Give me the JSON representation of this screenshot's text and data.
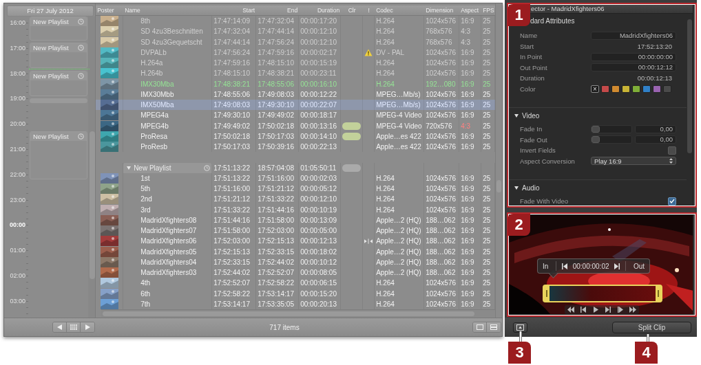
{
  "calendar": {
    "date": "Fri 27 July 2012",
    "hours": [
      {
        "label": "16:00",
        "emphasized": false
      },
      {
        "label": "17:00",
        "emphasized": false
      },
      {
        "label": "18:00",
        "emphasized": false
      },
      {
        "label": "19:00",
        "emphasized": false
      },
      {
        "label": "20:00",
        "emphasized": false
      },
      {
        "label": "21:00",
        "emphasized": false
      },
      {
        "label": "22:00",
        "emphasized": false
      },
      {
        "label": "23:00",
        "emphasized": false
      },
      {
        "label": "00:00",
        "emphasized": true
      },
      {
        "label": "01:00",
        "emphasized": false
      },
      {
        "label": "02:00",
        "emphasized": false
      },
      {
        "label": "03:00",
        "emphasized": false
      }
    ],
    "blocks": [
      {
        "kind": "playlist",
        "title": "New Playlist"
      },
      {
        "kind": "playlist",
        "title": "New Playlist"
      },
      {
        "kind": "playlist",
        "title": "New Playlist"
      },
      {
        "kind": "bar"
      },
      {
        "kind": "playlist",
        "title": "New Playlist"
      }
    ]
  },
  "table": {
    "columns": [
      "Poster",
      "Name",
      "Start",
      "End",
      "Duration",
      "Clr",
      "!",
      "Codec",
      "Dimension",
      "Aspect",
      "FPS"
    ],
    "rows": [
      {
        "kind": "clip",
        "name": "8th",
        "start": "17:47:14:09",
        "end": "17:47:32:04",
        "duration": "00:00:17:20",
        "codec": "H.264",
        "dimension": "1024x576",
        "aspect": "16:9",
        "fps": "25",
        "offline": true,
        "playing": false,
        "selected": false,
        "warning": false,
        "split": false,
        "aspect_warning": false
      },
      {
        "kind": "clip",
        "name": "SD 4zu3Beschnitten",
        "start": "17:47:32:04",
        "end": "17:47:44:14",
        "duration": "00:00:12:10",
        "codec": "H.264",
        "dimension": "768x576",
        "aspect": "4:3",
        "fps": "25",
        "offline": true,
        "playing": false,
        "selected": false,
        "warning": false,
        "split": false,
        "aspect_warning": false
      },
      {
        "kind": "clip",
        "name": "SD 4zu3Gequetscht",
        "start": "17:47:44:14",
        "end": "17:47:56:24",
        "duration": "00:00:12:10",
        "codec": "H.264",
        "dimension": "768x576",
        "aspect": "4:3",
        "fps": "25",
        "offline": true,
        "playing": false,
        "selected": false,
        "warning": false,
        "split": false,
        "aspect_warning": false
      },
      {
        "kind": "clip",
        "name": "DVPALb",
        "start": "17:47:56:24",
        "end": "17:47:59:16",
        "duration": "00:00:02:17",
        "codec": "DV - PAL",
        "dimension": "1024x576",
        "aspect": "16:9",
        "fps": "25",
        "offline": true,
        "playing": false,
        "selected": false,
        "warning": true,
        "split": false,
        "aspect_warning": false
      },
      {
        "kind": "clip",
        "name": "H.264a",
        "start": "17:47:59:16",
        "end": "17:48:15:10",
        "duration": "00:00:15:19",
        "codec": "H.264",
        "dimension": "1024x576",
        "aspect": "16:9",
        "fps": "25",
        "offline": true,
        "playing": false,
        "selected": false,
        "warning": false,
        "split": false,
        "aspect_warning": false
      },
      {
        "kind": "clip",
        "name": "H.264b",
        "start": "17:48:15:10",
        "end": "17:48:38:21",
        "duration": "00:00:23:11",
        "codec": "H.264",
        "dimension": "1024x576",
        "aspect": "16:9",
        "fps": "25",
        "offline": true,
        "playing": false,
        "selected": false,
        "warning": false,
        "split": false,
        "aspect_warning": false
      },
      {
        "kind": "clip",
        "name": "IMX30Mba",
        "start": "17:48:38:21",
        "end": "17:48:55:06",
        "duration": "00:00:16:10",
        "codec": "H.264",
        "dimension": "192…080",
        "aspect": "16:9",
        "fps": "25",
        "offline": false,
        "playing": true,
        "selected": false,
        "warning": false,
        "split": false,
        "aspect_warning": false
      },
      {
        "kind": "clip",
        "name": "IMX30Mbb",
        "start": "17:48:55:06",
        "end": "17:49:08:03",
        "duration": "00:00:12:22",
        "codec": "MPEG…Mb/s)",
        "dimension": "1024x576",
        "aspect": "16:9",
        "fps": "25",
        "offline": false,
        "playing": false,
        "selected": false,
        "warning": false,
        "split": false,
        "aspect_warning": false
      },
      {
        "kind": "clip",
        "name": "IMX50Mba",
        "start": "17:49:08:03",
        "end": "17:49:30:10",
        "duration": "00:00:22:07",
        "codec": "MPEG…Mb/s)",
        "dimension": "1024x576",
        "aspect": "16:9",
        "fps": "25",
        "offline": false,
        "playing": false,
        "selected": true,
        "warning": false,
        "split": false,
        "aspect_warning": false
      },
      {
        "kind": "clip",
        "name": "MPEG4a",
        "start": "17:49:30:10",
        "end": "17:49:49:02",
        "duration": "00:00:18:17",
        "codec": "MPEG-4 Video",
        "dimension": "1024x576",
        "aspect": "16:9",
        "fps": "25",
        "offline": false,
        "playing": false,
        "selected": false,
        "warning": false,
        "split": false,
        "aspect_warning": false
      },
      {
        "kind": "clip",
        "name": "MPEG4b",
        "start": "17:49:49:02",
        "end": "17:50:02:18",
        "duration": "00:00:13:16",
        "color": "#c2d19a",
        "codec": "MPEG-4 Video",
        "dimension": "720x576",
        "aspect": "4:3",
        "fps": "25",
        "offline": false,
        "playing": false,
        "selected": false,
        "warning": false,
        "split": false,
        "aspect_warning": true
      },
      {
        "kind": "clip",
        "name": "ProResa",
        "start": "17:50:02:18",
        "end": "17:50:17:03",
        "duration": "00:00:14:10",
        "color": "#c2d19a",
        "codec": "Apple…es 422",
        "dimension": "1024x576",
        "aspect": "16:9",
        "fps": "25",
        "offline": false,
        "playing": false,
        "selected": false,
        "warning": false,
        "split": false,
        "aspect_warning": false
      },
      {
        "kind": "clip",
        "name": "ProResb",
        "start": "17:50:17:03",
        "end": "17:50:39:16",
        "duration": "00:00:22:13",
        "codec": "Apple…es 422",
        "dimension": "1024x576",
        "aspect": "16:9",
        "fps": "25",
        "offline": false,
        "playing": false,
        "selected": false,
        "warning": false,
        "split": false,
        "aspect_warning": false
      },
      {
        "kind": "playlist",
        "name": "New Playlist",
        "start": "17:51:13:22",
        "end": "18:57:04:08",
        "duration": "01:05:50:11",
        "color": "#aaaaaa",
        "offline": false,
        "playing": false,
        "selected": false,
        "expanded": true,
        "children": [
          {
            "kind": "clip",
            "name": "1st",
            "start": "17:51:13:22",
            "end": "17:51:16:00",
            "duration": "00:00:02:03",
            "codec": "H.264",
            "dimension": "1024x576",
            "aspect": "16:9",
            "fps": "25",
            "offline": false,
            "playing": false,
            "selected": false,
            "warning": false,
            "split": false,
            "aspect_warning": false
          },
          {
            "kind": "clip",
            "name": "5th",
            "start": "17:51:16:00",
            "end": "17:51:21:12",
            "duration": "00:00:05:12",
            "codec": "H.264",
            "dimension": "1024x576",
            "aspect": "16:9",
            "fps": "25",
            "offline": false,
            "playing": false,
            "selected": false,
            "warning": false,
            "split": false,
            "aspect_warning": false
          },
          {
            "kind": "clip",
            "name": "2nd",
            "start": "17:51:21:12",
            "end": "17:51:33:22",
            "duration": "00:00:12:10",
            "codec": "H.264",
            "dimension": "1024x576",
            "aspect": "16:9",
            "fps": "25",
            "offline": false,
            "playing": false,
            "selected": false,
            "warning": false,
            "split": false,
            "aspect_warning": false
          },
          {
            "kind": "clip",
            "name": "3rd",
            "start": "17:51:33:22",
            "end": "17:51:44:16",
            "duration": "00:00:10:19",
            "codec": "H.264",
            "dimension": "1024x576",
            "aspect": "16:9",
            "fps": "25",
            "offline": false,
            "playing": false,
            "selected": false,
            "warning": false,
            "split": false,
            "aspect_warning": false
          },
          {
            "kind": "clip",
            "name": "MadridXfighters08",
            "start": "17:51:44:16",
            "end": "17:51:58:00",
            "duration": "00:00:13:09",
            "codec": "Apple…2 (HQ)",
            "dimension": "188…062",
            "aspect": "16:9",
            "fps": "25",
            "offline": false,
            "playing": false,
            "selected": false,
            "warning": false,
            "split": false,
            "aspect_warning": false
          },
          {
            "kind": "clip",
            "name": "MadridXfighters07",
            "start": "17:51:58:00",
            "end": "17:52:03:00",
            "duration": "00:00:05:00",
            "codec": "Apple…2 (HQ)",
            "dimension": "188…062",
            "aspect": "16:9",
            "fps": "25",
            "offline": false,
            "playing": false,
            "selected": false,
            "warning": false,
            "split": false,
            "aspect_warning": false
          },
          {
            "kind": "clip",
            "name": "MadridXfighters06",
            "start": "17:52:03:00",
            "end": "17:52:15:13",
            "duration": "00:00:12:13",
            "codec": "Apple…2 (HQ)",
            "dimension": "188…062",
            "aspect": "16:9",
            "fps": "25",
            "offline": false,
            "playing": false,
            "selected": false,
            "warning": false,
            "split": true,
            "aspect_warning": false
          },
          {
            "kind": "clip",
            "name": "MadridXfighters05",
            "start": "17:52:15:13",
            "end": "17:52:33:15",
            "duration": "00:00:18:02",
            "codec": "Apple…2 (HQ)",
            "dimension": "188…062",
            "aspect": "16:9",
            "fps": "25",
            "offline": false,
            "playing": false,
            "selected": false,
            "warning": false,
            "split": false,
            "aspect_warning": false
          },
          {
            "kind": "clip",
            "name": "MadridXfighters04",
            "start": "17:52:33:15",
            "end": "17:52:44:02",
            "duration": "00:00:10:12",
            "codec": "Apple…2 (HQ)",
            "dimension": "188…062",
            "aspect": "16:9",
            "fps": "25",
            "offline": false,
            "playing": false,
            "selected": false,
            "warning": false,
            "split": false,
            "aspect_warning": false
          },
          {
            "kind": "clip",
            "name": "MadridXfighters03",
            "start": "17:52:44:02",
            "end": "17:52:52:07",
            "duration": "00:00:08:05",
            "codec": "Apple…2 (HQ)",
            "dimension": "188…062",
            "aspect": "16:9",
            "fps": "25",
            "offline": false,
            "playing": false,
            "selected": false,
            "warning": false,
            "split": false,
            "aspect_warning": false
          },
          {
            "kind": "clip",
            "name": "4th",
            "start": "17:52:52:07",
            "end": "17:52:58:22",
            "duration": "00:00:06:15",
            "codec": "H.264",
            "dimension": "1024x576",
            "aspect": "16:9",
            "fps": "25",
            "offline": false,
            "playing": false,
            "selected": false,
            "warning": false,
            "split": false,
            "aspect_warning": false
          },
          {
            "kind": "clip",
            "name": "6th",
            "start": "17:52:58:22",
            "end": "17:53:14:17",
            "duration": "00:00:15:20",
            "codec": "H.264",
            "dimension": "1024x576",
            "aspect": "16:9",
            "fps": "25",
            "offline": false,
            "playing": false,
            "selected": false,
            "warning": false,
            "split": false,
            "aspect_warning": false
          },
          {
            "kind": "clip",
            "name": "7th",
            "start": "17:53:14:17",
            "end": "17:53:35:05",
            "duration": "00:00:20:13",
            "codec": "H.264",
            "dimension": "1024x576",
            "aspect": "16:9",
            "fps": "25",
            "offline": false,
            "playing": false,
            "selected": false,
            "warning": false,
            "split": false,
            "aspect_warning": false
          }
        ]
      }
    ]
  },
  "status_bar": {
    "text": "717 items"
  },
  "inspector": {
    "title": "ector - MadridXfighters06",
    "sections": [
      {
        "heading": "dard Attributes",
        "fields": [
          {
            "label": "Name",
            "kind": "field",
            "value": "MadridXfighters06"
          },
          {
            "label": "Start",
            "kind": "text",
            "value": "17:52:13:20"
          },
          {
            "label": "In Point",
            "kind": "field",
            "value": "00:00:00:00"
          },
          {
            "label": "Out Point",
            "kind": "field",
            "value": "00:00:12:12"
          },
          {
            "label": "Duration",
            "kind": "text",
            "value": "00:00:12:13"
          },
          {
            "label": "Color",
            "kind": "swatches",
            "swatches": [
              {
                "kind": "none",
                "label": "×",
                "selected": true
              },
              {
                "kind": "color",
                "color": "#c44a4a",
                "selected": false
              },
              {
                "kind": "color",
                "color": "#d08a30",
                "selected": false
              },
              {
                "kind": "color",
                "color": "#c8b436",
                "selected": false
              },
              {
                "kind": "color",
                "color": "#7fae38",
                "selected": false
              },
              {
                "kind": "color",
                "color": "#3080c8",
                "selected": false
              },
              {
                "kind": "color",
                "color": "#9963b0",
                "selected": false
              },
              {
                "kind": "color",
                "color": "#4a4a4a",
                "selected": false
              }
            ]
          }
        ]
      },
      {
        "heading": "Video",
        "expanded": true,
        "fields": [
          {
            "label": "Fade In",
            "kind": "slider",
            "level": 0,
            "value": "0,00"
          },
          {
            "label": "Fade Out",
            "kind": "slider",
            "level": 0,
            "value": "0,00"
          },
          {
            "label": "Invert Fields",
            "kind": "checkbox",
            "checked": false
          },
          {
            "label": "Aspect Conversion",
            "kind": "popup",
            "value": "Play 16:9"
          }
        ]
      },
      {
        "heading": "Audio",
        "expanded": true,
        "fields": [
          {
            "label": "Fade With Video",
            "kind": "checkbox",
            "checked": true
          }
        ]
      }
    ]
  },
  "viewer": {
    "in_label": "In",
    "timecode": "00:00:00:02",
    "out_label": "Out",
    "split_button": "Split Clip"
  },
  "callouts": [
    "1",
    "2",
    "3",
    "4"
  ]
}
